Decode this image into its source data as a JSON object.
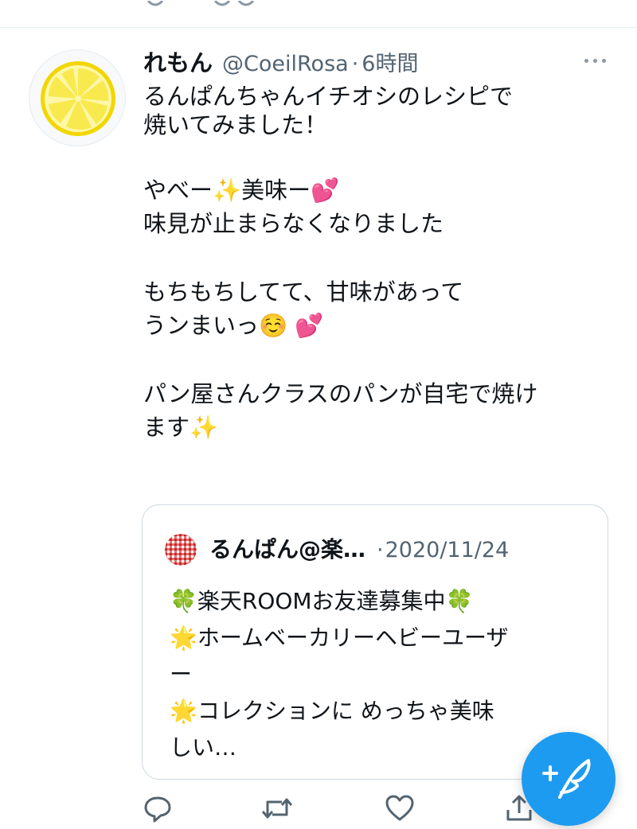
{
  "tweet": {
    "author_name": "れもん",
    "handle": "@CoeilRosa",
    "separator": "·",
    "time": "6時間",
    "lines": [
      "るんぱんちゃんイチオシのレシピで",
      "焼いてみました！",
      "",
      "やべー✨美味ー💕",
      "味見が止まらなくなりました",
      "",
      "もちもちしてて、甘味があって",
      "うンまいっ☺️ 💕",
      "",
      "パン屋さんクラスのパンが自宅で焼け",
      "ます✨"
    ]
  },
  "quote": {
    "author_name": "るんぱん@楽…",
    "separator": "·",
    "date": "2020/11/24",
    "lines": [
      "🍀楽天ROOMお友達募集中🍀",
      "🌟ホームベーカリーヘビーユーザ",
      "ー",
      "🌟コレクションに めっちゃ美味",
      "しい…"
    ]
  },
  "icons": {
    "avatar": "lemon-slice-avatar",
    "more": "more-horizontal-icon",
    "reply": "reply-icon",
    "retweet": "retweet-icon",
    "like": "like-icon",
    "share": "share-icon",
    "compose": "compose-tweet-icon"
  },
  "colors": {
    "accent": "#1d9bf0",
    "text": "#0f1419",
    "secondary": "#536471",
    "border": "#cfd9de",
    "lemon": "#f5e84a",
    "lemon_rind": "#f2d600"
  }
}
